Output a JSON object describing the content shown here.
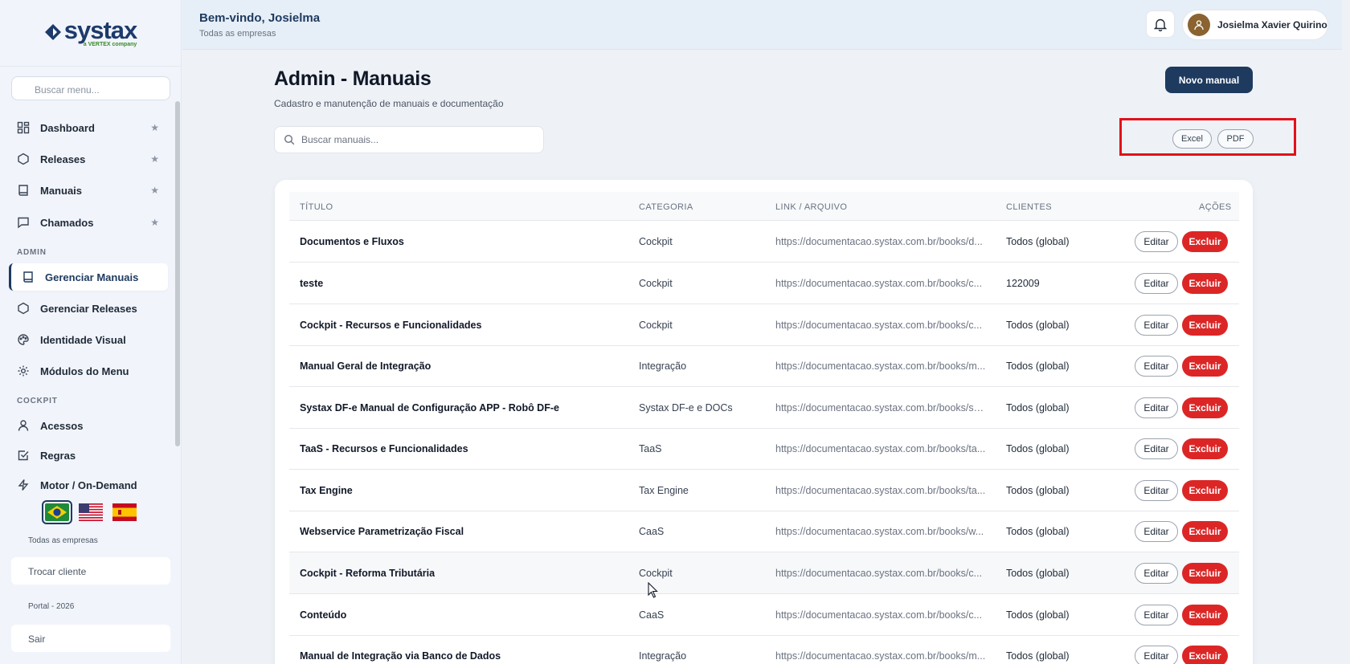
{
  "sidebar": {
    "logo_text": "systax",
    "logo_tagline": "a VERTEX company",
    "search_placeholder": "Buscar menu...",
    "main_items": [
      {
        "label": "Dashboard",
        "icon": "dashboard-icon",
        "favorite": true
      },
      {
        "label": "Releases",
        "icon": "hexagon-icon",
        "favorite": true
      },
      {
        "label": "Manuais",
        "icon": "book-icon",
        "favorite": true
      },
      {
        "label": "Chamados",
        "icon": "chat-icon",
        "favorite": true
      }
    ],
    "admin_label": "ADMIN",
    "admin_items": [
      {
        "label": "Gerenciar Manuais",
        "icon": "book-icon",
        "active": true
      },
      {
        "label": "Gerenciar Releases",
        "icon": "hexagon-icon"
      },
      {
        "label": "Identidade Visual",
        "icon": "palette-icon"
      },
      {
        "label": "Módulos do Menu",
        "icon": "gear-icon"
      }
    ],
    "cockpit_label": "COCKPIT",
    "cockpit_items": [
      {
        "label": "Acessos",
        "icon": "user-icon"
      },
      {
        "label": "Regras",
        "icon": "checkbox-icon"
      },
      {
        "label": "Motor / On-Demand",
        "icon": "lightning-icon"
      }
    ],
    "languages": [
      "pt-BR",
      "en-US",
      "es-ES"
    ],
    "selected_language": "pt-BR",
    "company_scope": "Todas as empresas",
    "switch_client_label": "Trocar cliente",
    "portal_year": "Portal - 2026",
    "logout_label": "Sair"
  },
  "header": {
    "welcome": "Bem-vindo, Josielma",
    "subtitle": "Todas as empresas",
    "user_name": "Josielma Xavier Quirino"
  },
  "main": {
    "title": "Admin - Manuais",
    "subtitle": "Cadastro e manutenção de manuais e documentação",
    "new_button": "Novo manual",
    "search_placeholder": "Buscar manuais...",
    "export_excel": "Excel",
    "export_pdf": "PDF",
    "columns": [
      "TÍTULO",
      "CATEGORIA",
      "LINK / ARQUIVO",
      "CLIENTES",
      "AÇÕES"
    ],
    "edit_label": "Editar",
    "delete_label": "Excluir",
    "rows": [
      {
        "title": "Documentos e Fluxos",
        "category": "Cockpit",
        "link": "https://documentacao.systax.com.br/books/d...",
        "clients": "Todos (global)"
      },
      {
        "title": "teste",
        "category": "Cockpit",
        "link": "https://documentacao.systax.com.br/books/c...",
        "clients": "122009"
      },
      {
        "title": "Cockpit - Recursos e Funcionalidades",
        "category": "Cockpit",
        "link": "https://documentacao.systax.com.br/books/c...",
        "clients": "Todos (global)"
      },
      {
        "title": "Manual Geral de Integração",
        "category": "Integração",
        "link": "https://documentacao.systax.com.br/books/m...",
        "clients": "Todos (global)"
      },
      {
        "title": "Systax DF-e Manual de Configuração APP - Robô DF-e",
        "category": "Systax DF-e e DOCs",
        "link": "https://documentacao.systax.com.br/books/sy...",
        "clients": "Todos (global)"
      },
      {
        "title": "TaaS - Recursos e Funcionalidades",
        "category": "TaaS",
        "link": "https://documentacao.systax.com.br/books/ta...",
        "clients": "Todos (global)"
      },
      {
        "title": "Tax Engine",
        "category": "Tax Engine",
        "link": "https://documentacao.systax.com.br/books/ta...",
        "clients": "Todos (global)"
      },
      {
        "title": "Webservice Parametrização Fiscal",
        "category": "CaaS",
        "link": "https://documentacao.systax.com.br/books/w...",
        "clients": "Todos (global)"
      },
      {
        "title": "Cockpit - Reforma Tributária",
        "category": "Cockpit",
        "link": "https://documentacao.systax.com.br/books/c...",
        "clients": "Todos (global)"
      },
      {
        "title": "Conteúdo",
        "category": "CaaS",
        "link": "https://documentacao.systax.com.br/books/c...",
        "clients": "Todos (global)"
      },
      {
        "title": "Manual de Integração via Banco de Dados",
        "category": "Integração",
        "link": "https://documentacao.systax.com.br/books/m...",
        "clients": "Todos (global)"
      }
    ]
  },
  "colors": {
    "primary": "#1e3a5f",
    "danger": "#dc2626",
    "highlight_box": "#e3101a"
  }
}
